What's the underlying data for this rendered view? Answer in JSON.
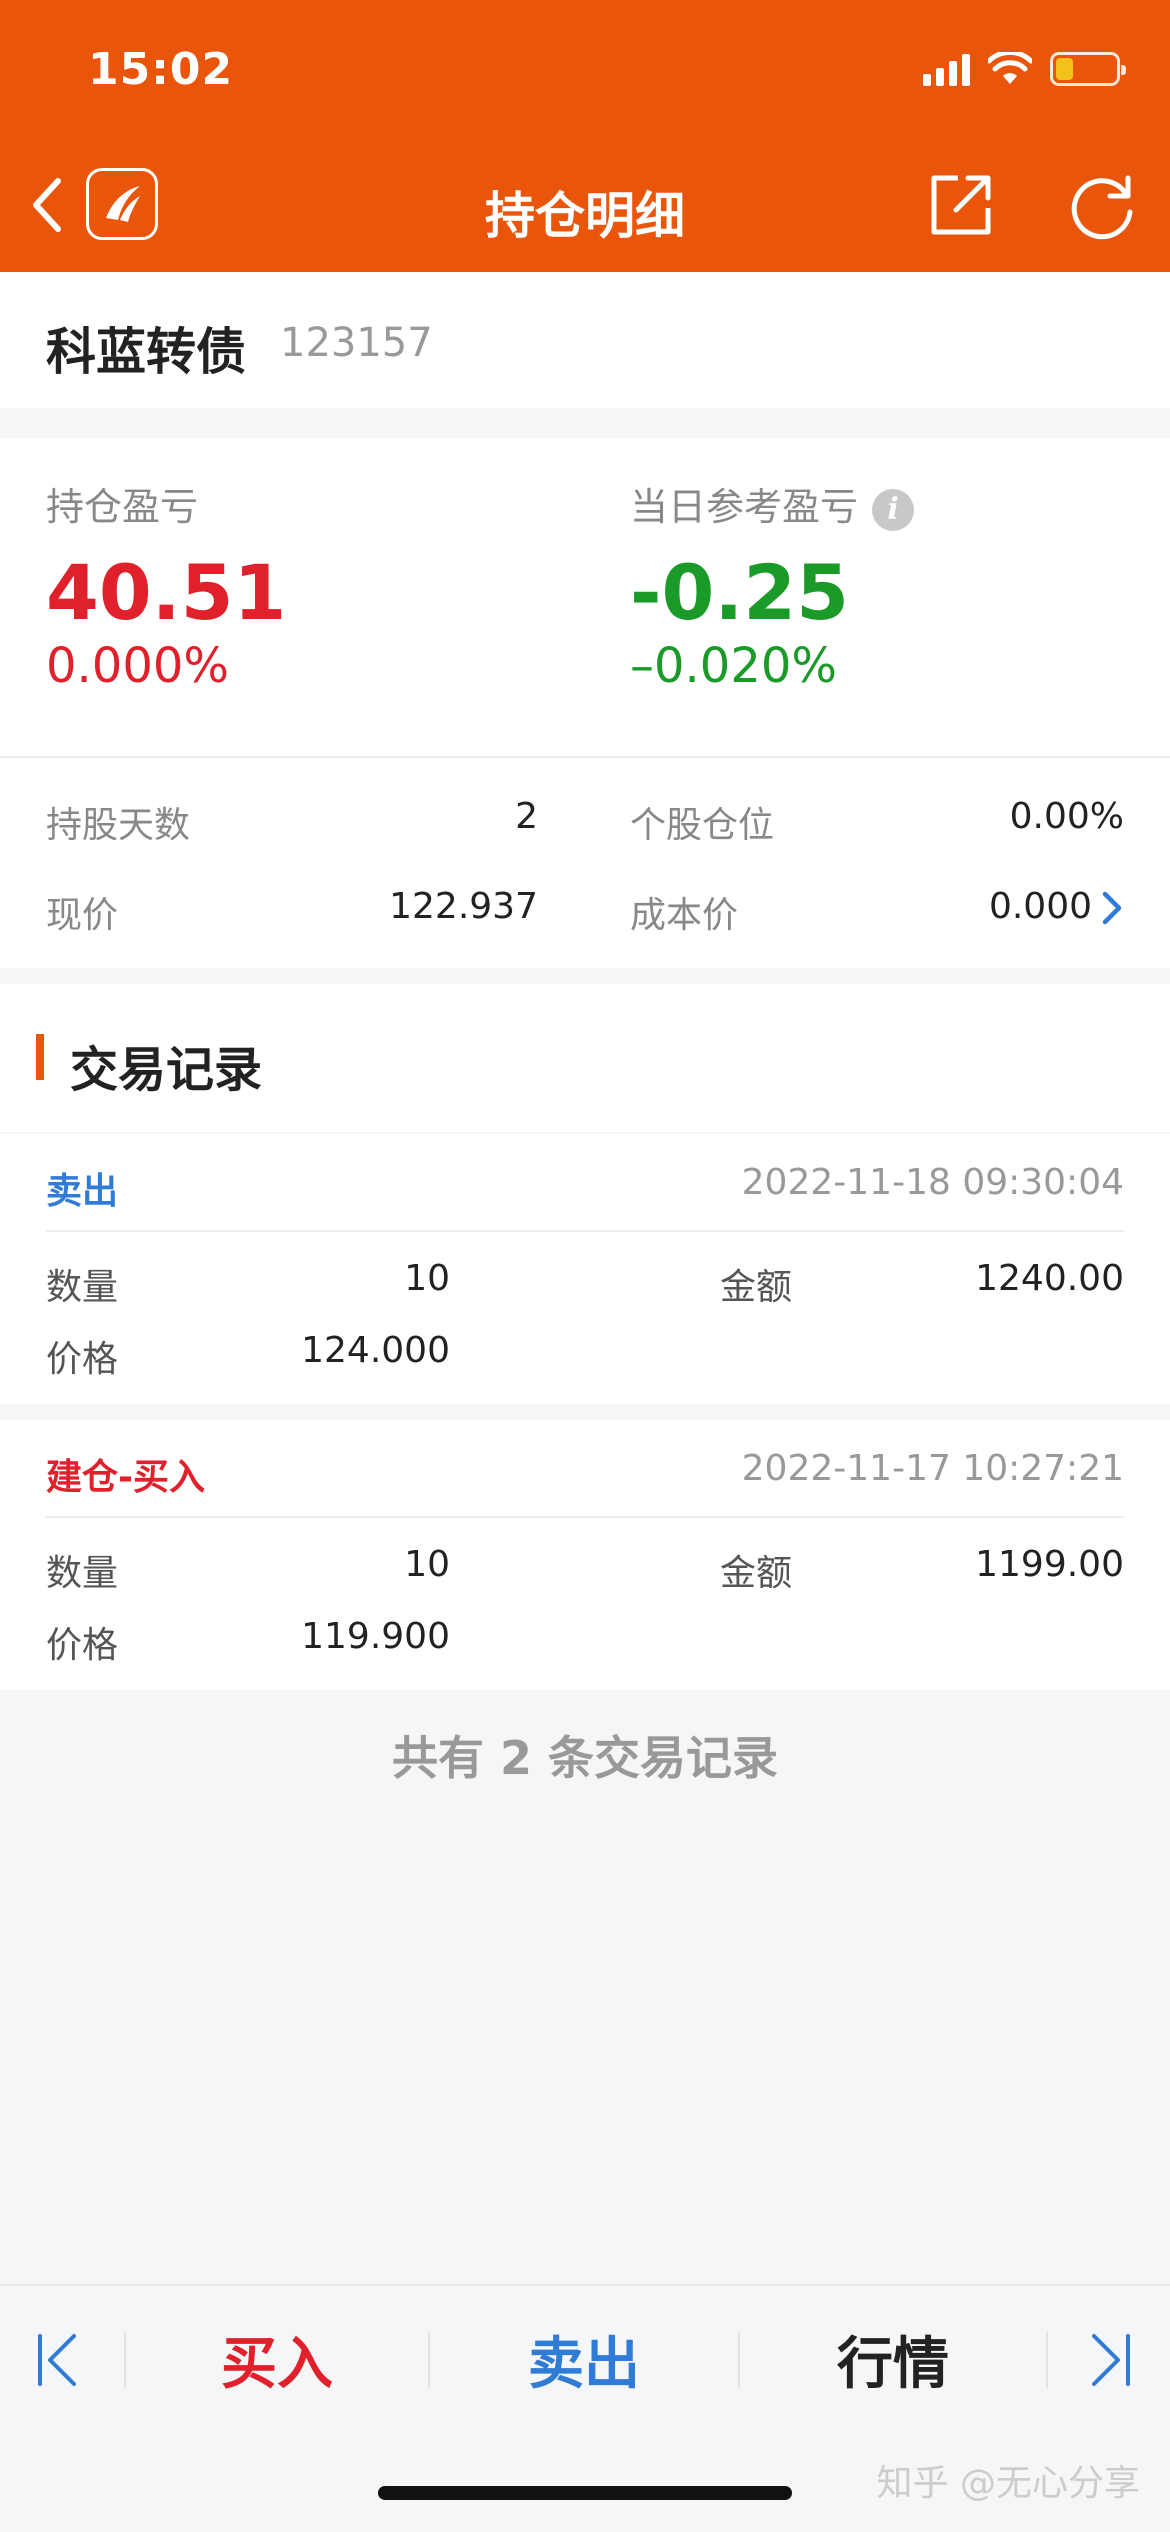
{
  "status_bar": {
    "time": "15:02"
  },
  "nav": {
    "title": "持仓明细"
  },
  "stock": {
    "name": "科蓝转债",
    "code": "123157"
  },
  "pnl": {
    "position_label": "持仓盈亏",
    "position_value": "40.51",
    "position_pct": "0.000%",
    "daily_label": "当日参考盈亏",
    "daily_value": "-0.25",
    "daily_pct": "–0.020%",
    "info_glyph": "i"
  },
  "stats": {
    "days_label": "持股天数",
    "days_value": "2",
    "weight_label": "个股仓位",
    "weight_value": "0.00%",
    "price_label": "现价",
    "price_value": "122.937",
    "cost_label": "成本价",
    "cost_value": "0.000"
  },
  "records": {
    "title": "交易记录",
    "items": [
      {
        "type": "卖出",
        "time": "2022-11-18 09:30:04",
        "qty_label": "数量",
        "qty": "10",
        "amount_label": "金额",
        "amount": "1240.00",
        "price_label": "价格",
        "price": "124.000"
      },
      {
        "type": "建仓-买入",
        "time": "2022-11-17 10:27:21",
        "qty_label": "数量",
        "qty": "10",
        "amount_label": "金额",
        "amount": "1199.00",
        "price_label": "价格",
        "price": "119.900"
      }
    ],
    "count_text": "共有 2 条交易记录"
  },
  "toolbar": {
    "buy": "买入",
    "sell": "卖出",
    "quote": "行情"
  },
  "watermark": "知乎 @无心分享",
  "colors": {
    "brand": "#e9550a",
    "up": "#e0202a",
    "down": "#1a9a28",
    "link": "#2f7bd6"
  },
  "icons": [
    "back-icon",
    "app-logo-icon",
    "share-icon",
    "refresh-icon",
    "info-icon",
    "chevron-right-icon",
    "first-page-icon",
    "last-page-icon"
  ]
}
